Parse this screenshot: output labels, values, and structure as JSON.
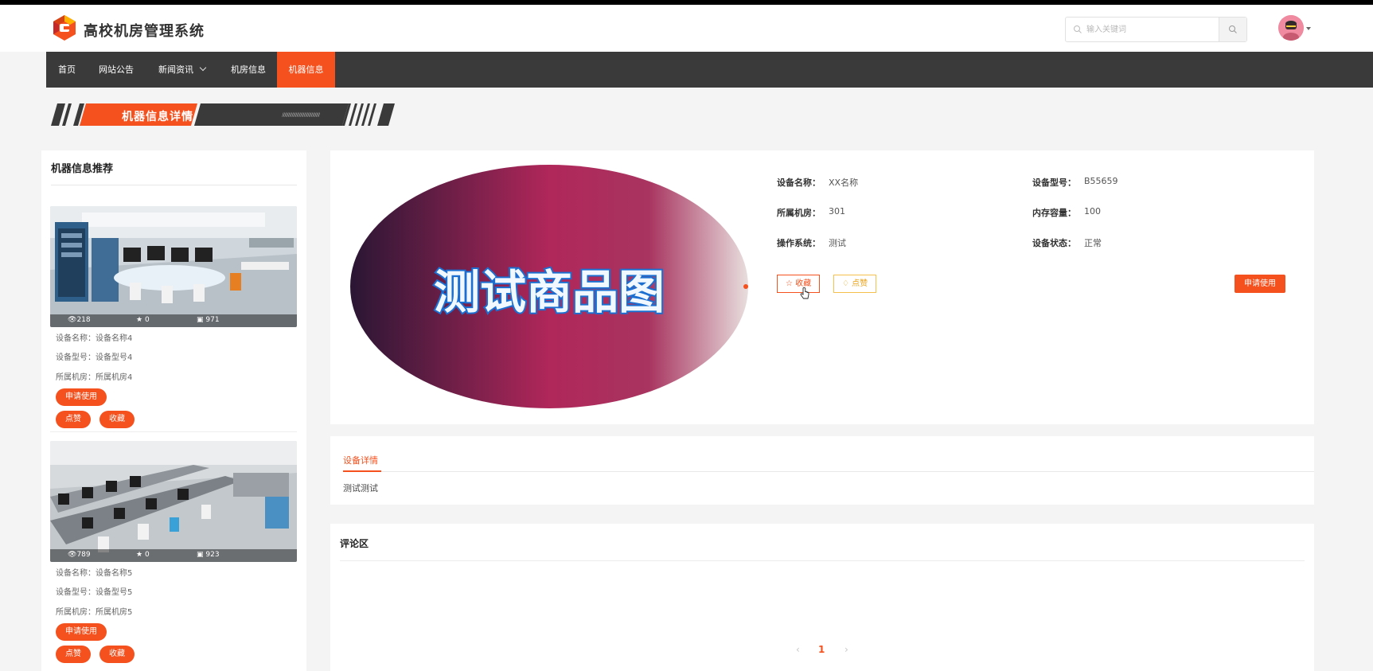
{
  "site": {
    "title": "高校机房管理系统"
  },
  "search": {
    "placeholder": "输入关键词"
  },
  "nav": {
    "items": [
      {
        "label": "首页"
      },
      {
        "label": "网站公告"
      },
      {
        "label": "新闻资讯"
      },
      {
        "label": "机房信息"
      },
      {
        "label": "机器信息"
      }
    ]
  },
  "banner": {
    "title": "机器信息详情",
    "decoration": "///////////////////////////////"
  },
  "sidebar": {
    "title": "机器信息推荐",
    "cards": [
      {
        "views": "218",
        "favorites": "0",
        "comments": "971",
        "name": "设备名称：设备名称4",
        "model": "设备型号：设备型号4",
        "room": "所属机房：所属机房4",
        "apply_label": "申请使用",
        "like_label": "点赞",
        "fav_label": "收藏"
      },
      {
        "views": "789",
        "favorites": "0",
        "comments": "923",
        "name": "设备名称：设备名称5",
        "model": "设备型号：设备型号5",
        "room": "所属机房：所属机房5",
        "apply_label": "申请使用",
        "like_label": "点赞",
        "fav_label": "收藏"
      }
    ]
  },
  "detail": {
    "image_text": "测试商品图",
    "fields": {
      "name_label": "设备名称：",
      "name_value": "XX名称",
      "model_label": "设备型号：",
      "model_value": "B55659",
      "room_label": "所属机房：",
      "room_value": "301",
      "memory_label": "内存容量：",
      "memory_value": "100",
      "os_label": "操作系统：",
      "os_value": "测试",
      "status_label": "设备状态：",
      "status_value": "正常"
    },
    "fav_label": "收藏",
    "like_label": "点赞",
    "apply_label": "申请使用"
  },
  "description": {
    "tab": "设备详情",
    "text": "测试测试"
  },
  "comments": {
    "title": "评论区",
    "current_page": "1"
  },
  "colors": {
    "accent": "#f4511e",
    "nav_bg": "#3a3a3a",
    "like": "#f5c14c"
  }
}
